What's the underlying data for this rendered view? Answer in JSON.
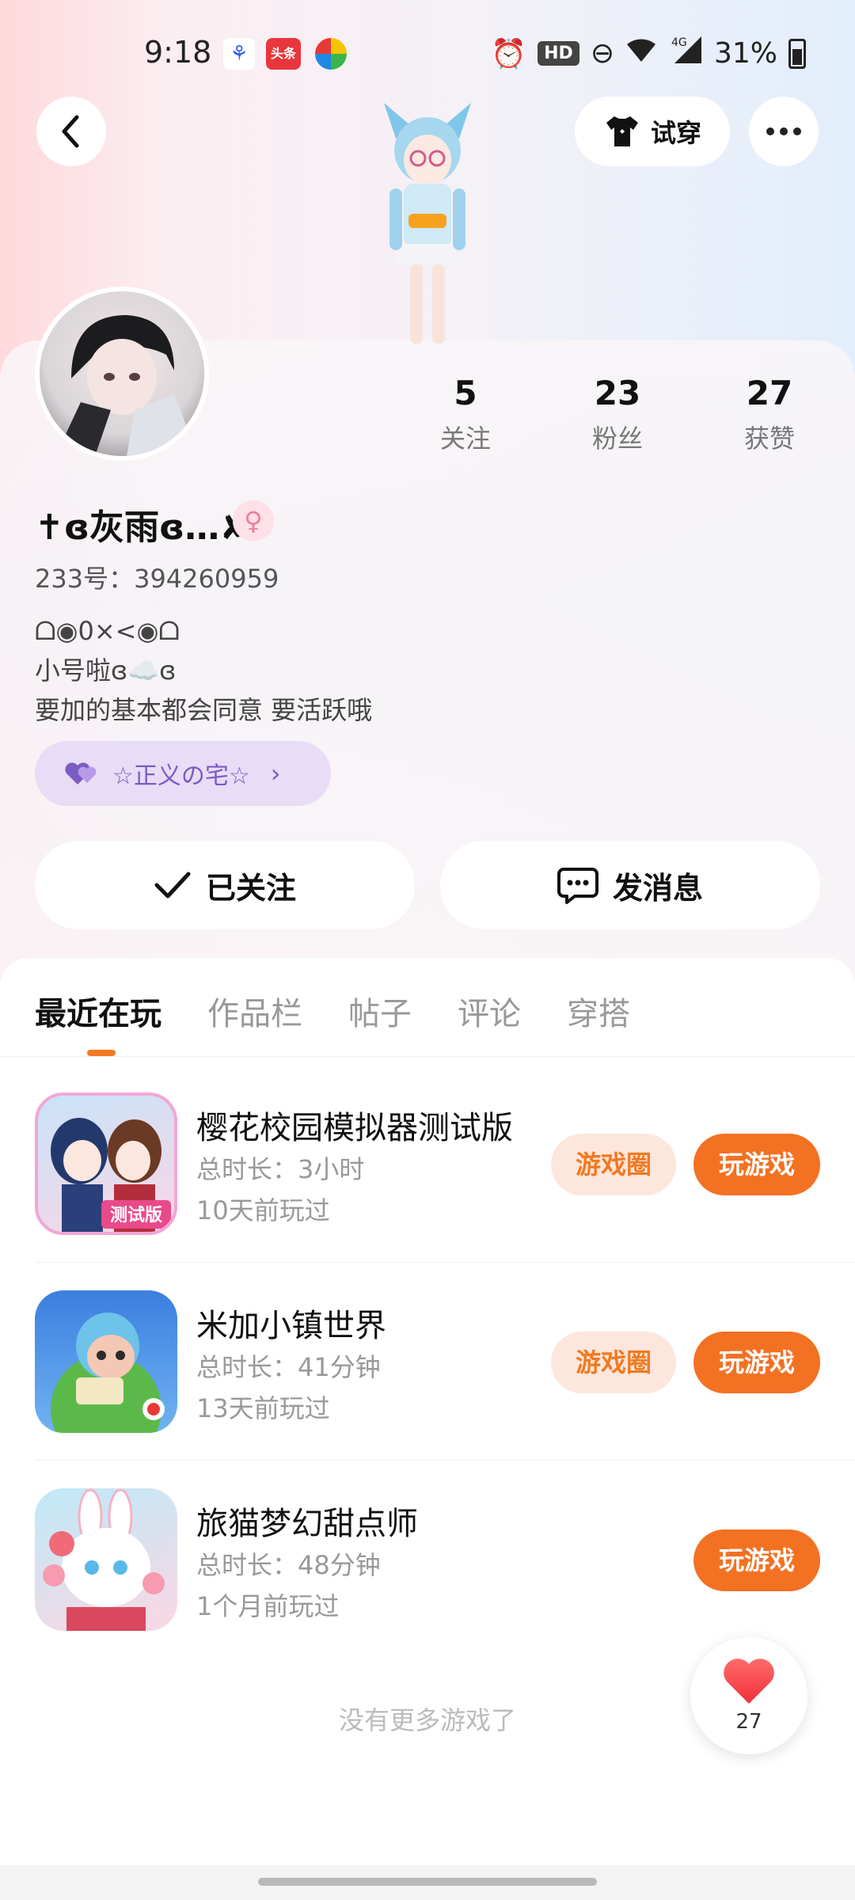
{
  "status_bar": {
    "time": "9:18",
    "apps": [
      "baidu-app-icon",
      "toutiao-app-icon",
      "colorful-app-icon"
    ],
    "toutiao_label": "头条",
    "hd_label": "HD",
    "network": "4G",
    "battery": "31%"
  },
  "header": {
    "tryon_label": "试穿"
  },
  "profile": {
    "username": "✝ɞ灰雨ɞ…✘",
    "gender_symbol": "♀",
    "uid": "233号：394260959",
    "bio_lines": [
      "ᗝ◉0×<◉ᗝ",
      "小号啦ɞ☁️ɞ",
      "要加的基本都会同意 要活跃哦"
    ],
    "guild": "☆正义の宅☆",
    "stats": [
      {
        "value": "5",
        "label": "关注"
      },
      {
        "value": "23",
        "label": "粉丝"
      },
      {
        "value": "27",
        "label": "获赞"
      }
    ]
  },
  "actions": {
    "follow_label": "已关注",
    "message_label": "发消息"
  },
  "tabs": [
    "最近在玩",
    "作品栏",
    "帖子",
    "评论",
    "穿搭"
  ],
  "games": [
    {
      "title": "樱花校园模拟器测试版",
      "duration": "总时长：3小时",
      "last_played": "10天前玩过",
      "circle_label": "游戏圈",
      "play_label": "玩游戏",
      "icon_badge": "测试版"
    },
    {
      "title": "米加小镇世界",
      "duration": "总时长：41分钟",
      "last_played": "13天前玩过",
      "circle_label": "游戏圈",
      "play_label": "玩游戏"
    },
    {
      "title": "旅猫梦幻甜点师",
      "duration": "总时长：48分钟",
      "last_played": "1个月前玩过",
      "play_label": "玩游戏"
    }
  ],
  "footer": {
    "no_more": "没有更多游戏了",
    "like_count": "27"
  },
  "colors": {
    "accent": "#f37122",
    "accent_light": "#fde6db",
    "guild_bg": "#e8dcf6",
    "guild_text": "#7b5cc2"
  }
}
